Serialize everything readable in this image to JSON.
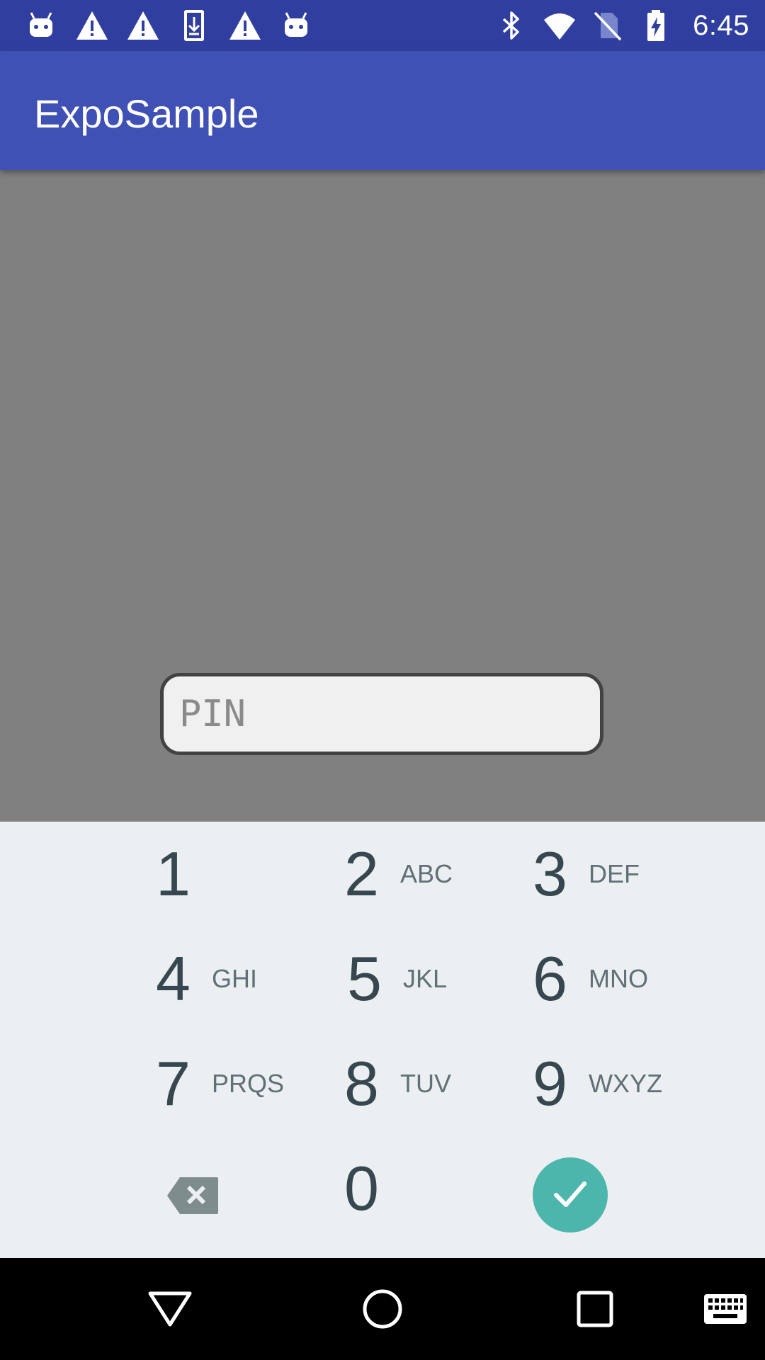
{
  "status_bar": {
    "time": "6:45",
    "left_icons": [
      "android-icon",
      "warning-icon",
      "warning-icon",
      "download-icon",
      "warning-icon",
      "android-icon"
    ],
    "right_icons": [
      "bluetooth-icon",
      "wifi-icon",
      "no-sim-icon",
      "battery-charging-icon"
    ],
    "background_color": "#303f9f"
  },
  "app_bar": {
    "title": "ExpoSample",
    "background_color": "#3f51b5"
  },
  "pin_field": {
    "placeholder": "PIN",
    "value": ""
  },
  "keypad": {
    "rows": [
      [
        {
          "digit": "1",
          "letters": ""
        },
        {
          "digit": "2",
          "letters": "ABC"
        },
        {
          "digit": "3",
          "letters": "DEF"
        }
      ],
      [
        {
          "digit": "4",
          "letters": "GHI"
        },
        {
          "digit": "5",
          "letters": "JKL"
        },
        {
          "digit": "6",
          "letters": "MNO"
        }
      ],
      [
        {
          "digit": "7",
          "letters": "PRQS"
        },
        {
          "digit": "8",
          "letters": "TUV"
        },
        {
          "digit": "9",
          "letters": "WXYZ"
        }
      ]
    ],
    "zero": {
      "digit": "0",
      "letters": ""
    },
    "delete_icon": "backspace-icon",
    "confirm_icon": "checkmark-icon",
    "confirm_color": "#4db6ac"
  },
  "nav_bar": {
    "icons": [
      "back-icon",
      "home-icon",
      "recents-icon",
      "keyboard-icon"
    ]
  }
}
